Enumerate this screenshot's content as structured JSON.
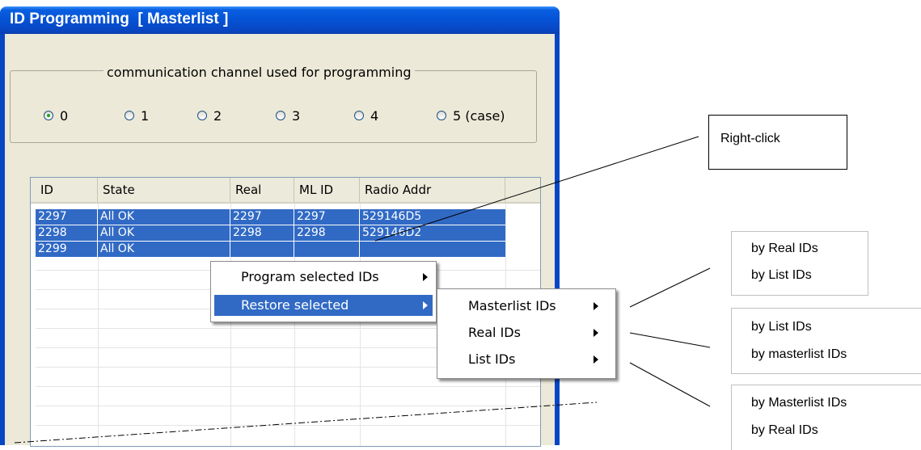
{
  "window": {
    "title": "ID Programming  [ Masterlist ]"
  },
  "channel_group": {
    "legend": "communication channel used for programming",
    "options": [
      "0",
      "1",
      "2",
      "3",
      "4",
      "5 (case)"
    ],
    "selected": "0"
  },
  "list": {
    "columns": [
      "ID",
      "State",
      "Real",
      "ML ID",
      "Radio Addr"
    ],
    "rows": [
      [
        "2297",
        "All OK",
        "2297",
        "2297",
        "529146D5"
      ],
      [
        "2298",
        "All OK",
        "2298",
        "2298",
        "529146D2"
      ],
      [
        "2299",
        "All OK",
        "",
        "",
        ""
      ]
    ]
  },
  "context_menu": {
    "items": [
      "Program selected IDs",
      "Restore selected"
    ],
    "highlighted": "Restore selected"
  },
  "submenu": {
    "items": [
      "Masterlist IDs",
      "Real IDs",
      "List IDs"
    ]
  },
  "annotations": {
    "right_click": "Right-click",
    "masterlist_options": [
      "by Real IDs",
      "by List IDs"
    ],
    "real_options": [
      "by List IDs",
      "by masterlist IDs"
    ],
    "list_options": [
      "by Masterlist IDs",
      "by Real IDs"
    ]
  },
  "colors": {
    "titlebar": "#0553d6",
    "selection": "#316ac5",
    "window_bg": "#ece9d8"
  }
}
